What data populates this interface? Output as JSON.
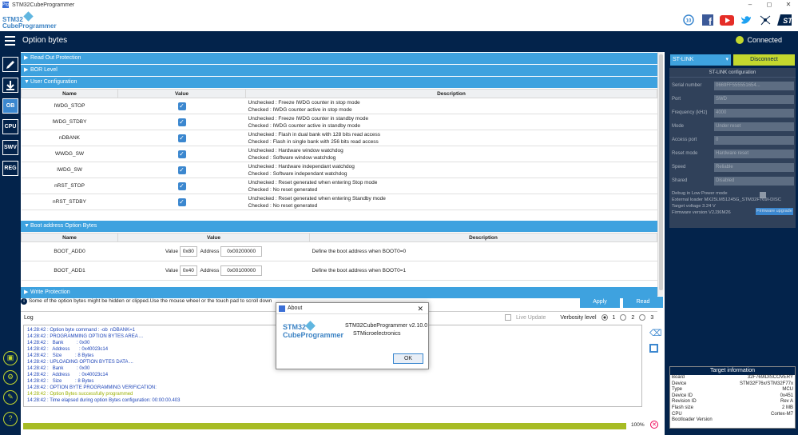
{
  "window": {
    "title": "STM32CubeProgrammer",
    "app_icon": "Prg",
    "controls": [
      "–",
      "◻",
      "✕"
    ]
  },
  "brand": {
    "line1": "STM32",
    "line2": "CubeProgrammer",
    "social_icons": [
      "badge-10-icon",
      "facebook-icon",
      "youtube-icon",
      "twitter-icon",
      "network-icon",
      "st-logo-icon"
    ]
  },
  "header": {
    "title": "Option bytes",
    "status": "Connected",
    "status_color": "#c4d82e"
  },
  "sidebar": {
    "buttons": [
      "OB",
      "CPU",
      "SWV",
      "REG"
    ]
  },
  "sections": {
    "rop": "Read Out Protection",
    "bor": "BOR Level",
    "user": "User Configuration",
    "boot": "Boot address Option Bytes",
    "wp": "Write Protection"
  },
  "user_table": {
    "headers": [
      "Name",
      "Value",
      "Description"
    ],
    "rows": [
      {
        "name": "IWDG_STOP",
        "checked": true,
        "d1": "Unchecked : Freeze IWDG counter in stop mode",
        "d2": "Checked     : IWDG counter active in stop mode"
      },
      {
        "name": "IWDG_STDBY",
        "checked": true,
        "d1": "Unchecked : Freeze IWDG counter in standby mode",
        "d2": "Checked     : IWDG counter active in standby mode"
      },
      {
        "name": "nDBANK",
        "checked": true,
        "d1": "Unchecked : Flash in dual bank with 128 bits read access",
        "d2": "Checked     : Flash in single bank with 256 bits read access"
      },
      {
        "name": "WWDG_SW",
        "checked": true,
        "d1": "Unchecked : Hardware window watchdog",
        "d2": "Checked     : Software window watchdog"
      },
      {
        "name": "IWDG_SW",
        "checked": true,
        "d1": "Unchecked : Hardware independant watchdog",
        "d2": "Checked     : Software independant watchdog"
      },
      {
        "name": "nRST_STOP",
        "checked": true,
        "d1": "Unchecked : Reset generated when entering Stop mode",
        "d2": "Checked     : No reset generated"
      },
      {
        "name": "nRST_STDBY",
        "checked": true,
        "d1": "Unchecked : Reset generated when entering Standby mode",
        "d2": "Checked     : No reset generated"
      }
    ]
  },
  "boot_table": {
    "headers": [
      "Name",
      "Value",
      "Description"
    ],
    "value_label": "Value",
    "address_label": "Address",
    "rows": [
      {
        "name": "BOOT_ADD0",
        "value": "0x80",
        "address": "0x00200000",
        "desc": "Define the boot address when BOOT0=0"
      },
      {
        "name": "BOOT_ADD1",
        "value": "0x40",
        "address": "0x00100000",
        "desc": "Define the boot address when BOOT0=1"
      }
    ]
  },
  "info_line": "Some of the option bytes might be hidden or clipped.Use the mouse wheel or the touch pad to scroll down",
  "buttons": {
    "apply": "Apply",
    "read": "Read"
  },
  "log": {
    "label": "Log",
    "live_update": "Live Update",
    "verbosity_label": "Verbosity level",
    "verbosity_options": [
      "1",
      "2",
      "3"
    ],
    "lines": [
      {
        "t": "14:28:42 : Option byte command : -ob  nDBANK=1",
        "c": "blue"
      },
      {
        "t": "14:28:42 : PROGRAMMING OPTION BYTES AREA ...",
        "c": "blue"
      },
      {
        "t": "14:28:42 :   Bank          : 0x00",
        "c": "blue"
      },
      {
        "t": "14:28:42 :   Address       : 0x40023c14",
        "c": "blue"
      },
      {
        "t": "14:28:42 :   Size          : 8 Bytes",
        "c": "blue"
      },
      {
        "t": "14:28:42 : UPLOADING OPTION BYTES DATA ...",
        "c": "blue"
      },
      {
        "t": "14:28:42 :   Bank          : 0x00",
        "c": "blue"
      },
      {
        "t": "14:28:42 :   Address       : 0x40023c14",
        "c": "blue"
      },
      {
        "t": "14:28:42 :   Size          : 8 Bytes",
        "c": "blue"
      },
      {
        "t": "14:28:42 : OPTION BYTE PROGRAMMING VERIFICATION:",
        "c": "blue"
      },
      {
        "t": "14:28:42 : Option Bytes successfully programmed",
        "c": "ok"
      },
      {
        "t": "14:28:42 : Time elapsed during option Bytes configuration: 00:00:00.403",
        "c": "blue"
      }
    ],
    "progress_fraction": 1.0,
    "progress_text": "100%"
  },
  "connection": {
    "interface": "ST-LINK",
    "disconnect": "Disconnect",
    "panel_title": "ST-LINK configuration",
    "fields": [
      {
        "label": "Serial number",
        "value": "0669FF555551654..."
      },
      {
        "label": "Port",
        "value": "SWD"
      },
      {
        "label": "Frequency (kHz)",
        "value": "4000"
      },
      {
        "label": "Mode",
        "value": "Under reset"
      },
      {
        "label": "Access port",
        "value": "0"
      },
      {
        "label": "Reset mode",
        "value": "Hardware reset"
      },
      {
        "label": "Speed",
        "value": "Reliable"
      },
      {
        "label": "Shared",
        "value": "Disabled"
      }
    ],
    "debug_low_power": "Debug in Low Power mode",
    "external_loader": "External loader     MX25LM51245G_STM32F769I-DISC",
    "target_voltage": "Target voltage     3.24 V",
    "firmware_version": "Firmware version  V2J36M26",
    "firmware_upgrade": "Firmware upgrade"
  },
  "target": {
    "title": "Target information",
    "rows": [
      {
        "k": "Board",
        "v": "32F769IDISCOVERY"
      },
      {
        "k": "Device",
        "v": "STM32F76x/STM32F77x"
      },
      {
        "k": "Type",
        "v": "MCU"
      },
      {
        "k": "Device ID",
        "v": "0x451"
      },
      {
        "k": "Revision ID",
        "v": "Rev A"
      },
      {
        "k": "Flash size",
        "v": "2 MB"
      },
      {
        "k": "CPU",
        "v": "Cortex-M7"
      },
      {
        "k": "Bootloader Version",
        "v": ""
      }
    ]
  },
  "about": {
    "title": "About",
    "logo1": "STM32",
    "logo2": "CubeProgrammer",
    "line1": "STM32CubeProgrammer v2.10.0",
    "line2": "STMicroelectronics",
    "ok": "OK"
  }
}
